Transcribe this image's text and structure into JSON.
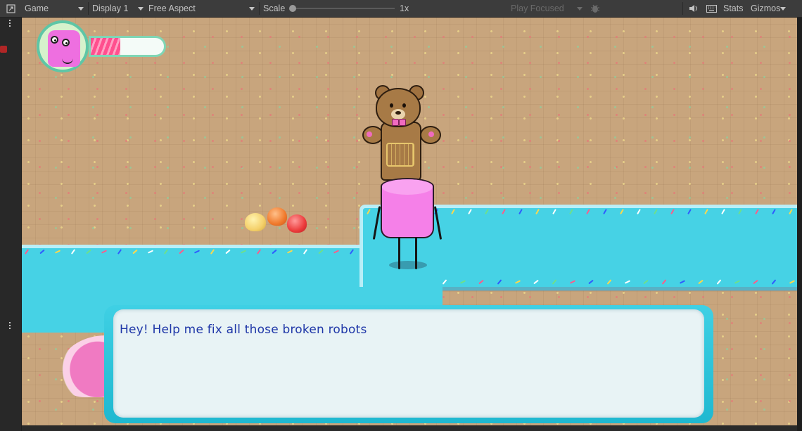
{
  "toolbar": {
    "window_icon": "game-window-icon",
    "view_tab": "Game",
    "display": "Display 1",
    "aspect": "Free Aspect",
    "scale_label": "Scale",
    "scale_value": "1x",
    "scale_level": 0,
    "play_mode": "Play Focused",
    "bug_icon": "bug-icon",
    "audio_icon": "speaker-icon",
    "keyboard_icon": "keyboard-icon",
    "stats_label": "Stats",
    "gizmos_label": "Gizmos"
  },
  "hud": {
    "portrait": "marshmallow-portrait",
    "health_fraction": 0.4,
    "health_color": "#ff4f8e"
  },
  "dialogue": {
    "text": "Hey! Help me fix all those broken robots"
  },
  "colors": {
    "ground": "#c8a57d",
    "water": "#46d2e5",
    "dialogue_frame": "#1fb8d0",
    "dialogue_text": "#1f37a8"
  }
}
